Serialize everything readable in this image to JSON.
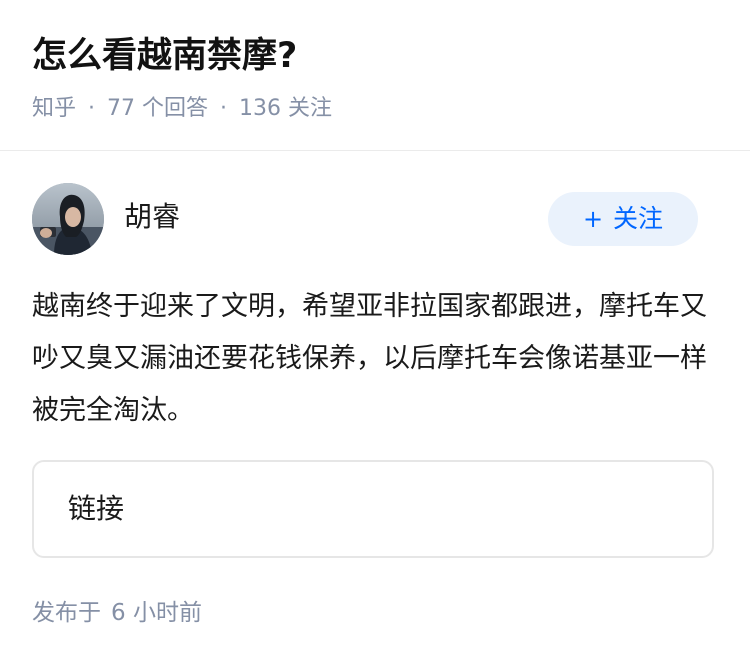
{
  "question": {
    "title": "怎么看越南禁摩?",
    "source": "知乎",
    "separator": "·",
    "answers_count": "77",
    "answers_label": "个回答",
    "followers_count": "136",
    "followers_label": "关注"
  },
  "author": {
    "name": "胡睿",
    "avatar_icon": "avatar-photo-icon",
    "follow_plus": "+",
    "follow_label": "关注"
  },
  "answer": {
    "content": "越南终于迎来了文明，希望亚非拉国家都跟进，摩托车又吵又臭又漏油还要花钱保养，以后摩托车会像诺基亚一样被完全淘汰。",
    "link_label": "链接",
    "publish_prefix": "发布于",
    "publish_time": "6 小时前"
  },
  "colors": {
    "accent": "#0066ff",
    "follow_bg": "#eaf2fc",
    "meta_text": "#8590a6",
    "divider": "#ebebeb"
  }
}
